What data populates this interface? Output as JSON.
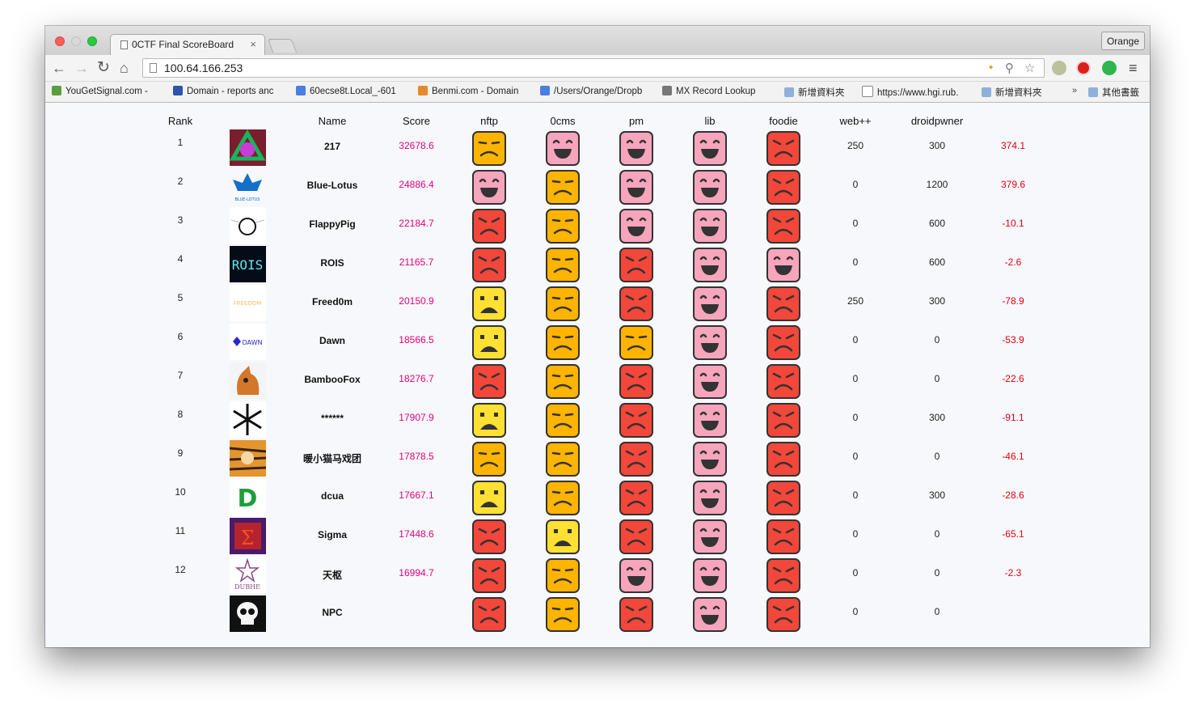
{
  "browser": {
    "tab_title": "0CTF Final ScoreBoard",
    "tab_close": "×",
    "profile_name": "Orange",
    "url": "100.64.166.253",
    "bookmarks": [
      {
        "label": "YouGetSignal.com - ",
        "icon": "globe-icon",
        "color": "#5a9e3c"
      },
      {
        "label": "Domain - reports anc",
        "icon": "bird-icon",
        "color": "#2d55a8"
      },
      {
        "label": "60ecse8t.Local_-601",
        "icon": "g-icon",
        "color": "#4a7fe0"
      },
      {
        "label": "Benmi.com - Domain",
        "icon": "pencil-icon",
        "color": "#e48a2b"
      },
      {
        "label": "/Users/Orange/Dropb",
        "icon": "g-icon",
        "color": "#4a7fe0"
      },
      {
        "label": "MX Record Lookup ",
        "icon": "gear-icon",
        "color": "#777777"
      },
      {
        "label": "新增資料夾",
        "icon": "folder-icon",
        "color": "#8fb0d8"
      },
      {
        "label": "https://www.hgi.rub.",
        "icon": "document-icon",
        "color": "#ffffff"
      },
      {
        "label": "新增資料夾",
        "icon": "folder-icon",
        "color": "#8fb0d8"
      }
    ],
    "bookmarks_overflow": "»",
    "other_bookmarks": "其他書籤"
  },
  "scoreboard": {
    "headers": {
      "rank": "Rank",
      "name": "Name",
      "score": "Score",
      "c1": "nftp",
      "c2": "0cms",
      "c3": "pm",
      "c4": "lib",
      "c5": "foodie",
      "c6": "web++",
      "c7": "droidpwner"
    },
    "face_colors": {
      "happy": "#f6a5bd",
      "neutral": "#ffb400",
      "angry": "#f2473a",
      "sad": "#ffe033"
    },
    "rows": [
      {
        "rank": "1",
        "name": "217",
        "score": "32678.6",
        "logo": "recycle-logo-icon",
        "status": [
          "neutral",
          "happy",
          "happy",
          "happy",
          "angry"
        ],
        "web": "250",
        "droid": "300",
        "delta": "374.1"
      },
      {
        "rank": "2",
        "name": "Blue-Lotus",
        "score": "24886.4",
        "logo": "blue-lotus-logo-icon",
        "status": [
          "happy",
          "neutral",
          "happy",
          "happy",
          "angry"
        ],
        "web": "0",
        "droid": "1200",
        "delta": "379.6"
      },
      {
        "rank": "3",
        "name": "FlappyPig",
        "score": "22184.7",
        "logo": "flappypig-logo-icon",
        "status": [
          "angry",
          "neutral",
          "happy",
          "happy",
          "angry"
        ],
        "web": "0",
        "droid": "600",
        "delta": "-10.1"
      },
      {
        "rank": "4",
        "name": "ROIS",
        "score": "21165.7",
        "logo": "rois-logo-icon",
        "status": [
          "angry",
          "neutral",
          "angry",
          "happy",
          "happy"
        ],
        "web": "0",
        "droid": "600",
        "delta": "-2.6"
      },
      {
        "rank": "5",
        "name": "Freed0m",
        "score": "20150.9",
        "logo": "freedom-logo-icon",
        "status": [
          "sad",
          "neutral",
          "angry",
          "happy",
          "angry"
        ],
        "web": "250",
        "droid": "300",
        "delta": "-78.9"
      },
      {
        "rank": "6",
        "name": "Dawn",
        "score": "18566.5",
        "logo": "dawn-logo-icon",
        "status": [
          "sad",
          "neutral",
          "neutral",
          "happy",
          "angry"
        ],
        "web": "0",
        "droid": "0",
        "delta": "-53.9"
      },
      {
        "rank": "7",
        "name": "BambooFox",
        "score": "18276.7",
        "logo": "bamboofox-logo-icon",
        "status": [
          "angry",
          "neutral",
          "angry",
          "happy",
          "angry"
        ],
        "web": "0",
        "droid": "0",
        "delta": "-22.6"
      },
      {
        "rank": "8",
        "name": "******",
        "score": "17907.9",
        "logo": "snowflake-logo-icon",
        "status": [
          "sad",
          "neutral",
          "angry",
          "happy",
          "angry"
        ],
        "web": "0",
        "droid": "300",
        "delta": "-91.1"
      },
      {
        "rank": "9",
        "name": "暖小猫马戏团",
        "score": "17878.5",
        "logo": "tiger-logo-icon",
        "status": [
          "neutral",
          "neutral",
          "angry",
          "happy",
          "angry"
        ],
        "web": "0",
        "droid": "0",
        "delta": "-46.1"
      },
      {
        "rank": "10",
        "name": "dcua",
        "score": "17667.1",
        "logo": "dcua-logo-icon",
        "status": [
          "sad",
          "neutral",
          "angry",
          "happy",
          "angry"
        ],
        "web": "0",
        "droid": "300",
        "delta": "-28.6"
      },
      {
        "rank": "11",
        "name": "Sigma",
        "score": "17448.6",
        "logo": "sigma-logo-icon",
        "status": [
          "angry",
          "sad",
          "angry",
          "happy",
          "angry"
        ],
        "web": "0",
        "droid": "0",
        "delta": "-65.1"
      },
      {
        "rank": "12",
        "name": "天枢",
        "score": "16994.7",
        "logo": "dubhe-logo-icon",
        "status": [
          "angry",
          "neutral",
          "happy",
          "happy",
          "angry"
        ],
        "web": "0",
        "droid": "0",
        "delta": "-2.3"
      },
      {
        "rank": "",
        "name": "NPC",
        "score": "",
        "logo": "skull-logo-icon",
        "status": [
          "angry",
          "neutral",
          "angry",
          "happy",
          "angry"
        ],
        "web": "0",
        "droid": "0",
        "delta": ""
      }
    ]
  }
}
